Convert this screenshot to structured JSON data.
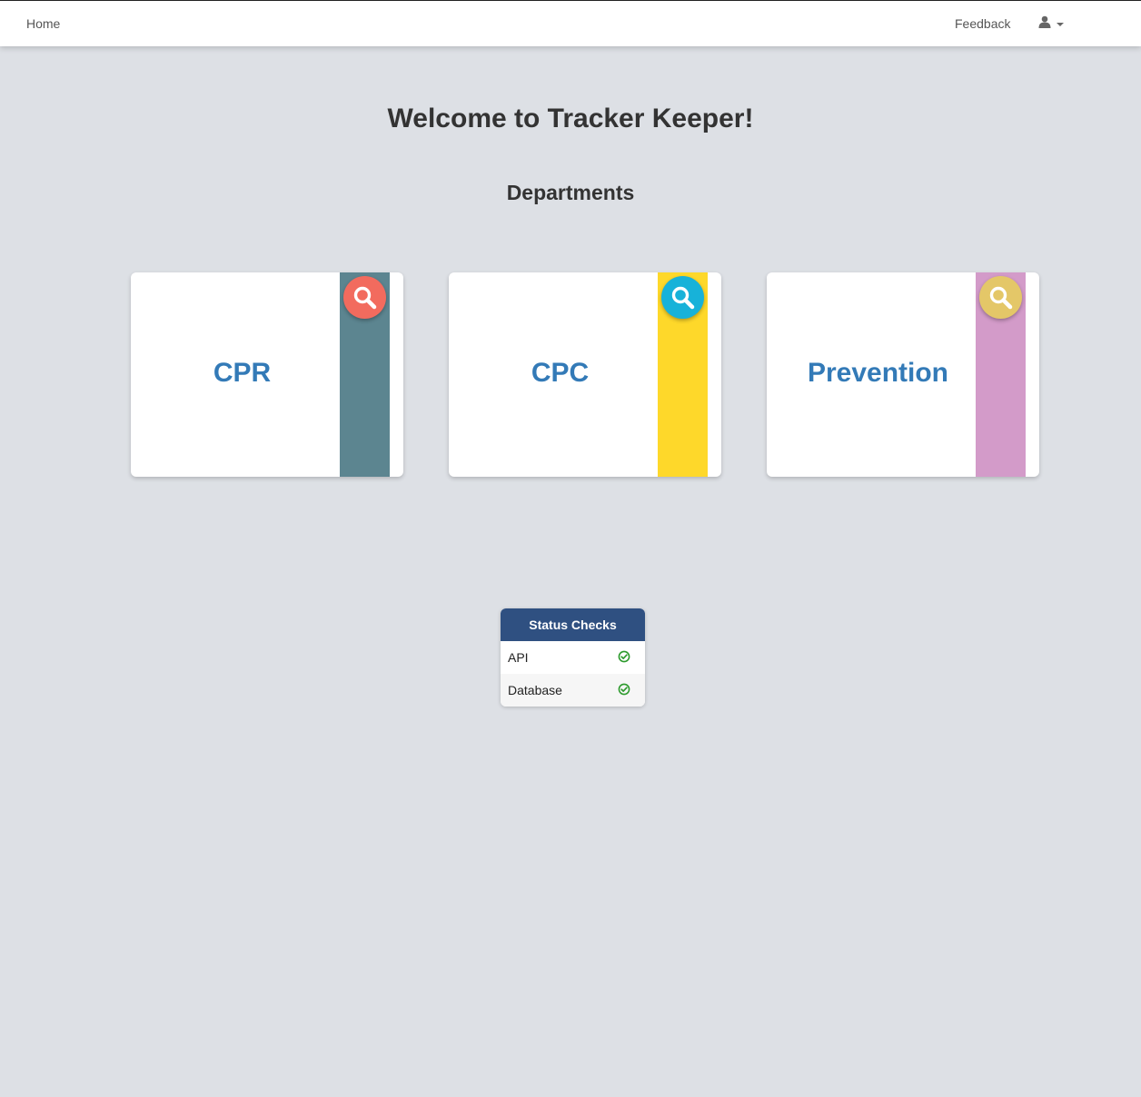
{
  "navbar": {
    "home_label": "Home",
    "feedback_label": "Feedback",
    "user_icon": "user-icon"
  },
  "main": {
    "title": "Welcome to Tracker Keeper!",
    "departments_heading": "Departments"
  },
  "departments": [
    {
      "label": "CPR",
      "strip_color": "#5c8590",
      "search_color": "#f26b5e",
      "icon": "search-icon"
    },
    {
      "label": "CPC",
      "strip_color": "#fed82a",
      "search_color": "#17b2d9",
      "icon": "search-icon"
    },
    {
      "label": "Prevention",
      "strip_color": "#d39bc9",
      "search_color": "#e4c768",
      "icon": "search-icon"
    }
  ],
  "status_checks": {
    "title": "Status Checks",
    "items": [
      {
        "label": "API",
        "status_icon": "check-circle-icon",
        "status_color": "#2c9a2c"
      },
      {
        "label": "Database",
        "status_icon": "check-circle-icon",
        "status_color": "#2c9a2c"
      }
    ]
  }
}
